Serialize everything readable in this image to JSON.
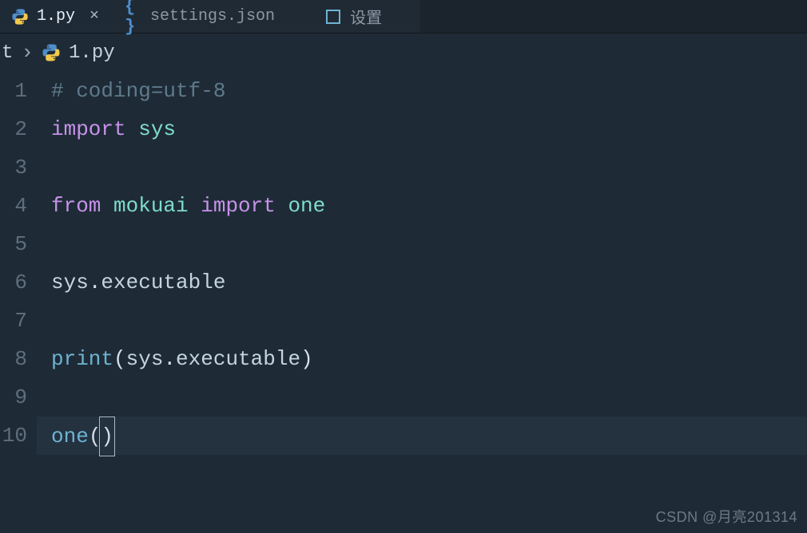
{
  "tabs": [
    {
      "label": "1.py",
      "iconName": "python-icon"
    },
    {
      "label": "settings.json",
      "iconName": "json-icon"
    },
    {
      "label": "设置",
      "iconName": "settings-icon"
    }
  ],
  "breadcrumb": {
    "parentHint": "t",
    "file": "1.py"
  },
  "code": {
    "lines": [
      {
        "n": "1",
        "tokens": [
          {
            "t": "# coding=utf-8",
            "c": "tok-comment"
          }
        ]
      },
      {
        "n": "2",
        "tokens": [
          {
            "t": "import ",
            "c": "tok-keyword"
          },
          {
            "t": "sys",
            "c": "tok-module"
          }
        ]
      },
      {
        "n": "3",
        "tokens": []
      },
      {
        "n": "4",
        "tokens": [
          {
            "t": "from ",
            "c": "tok-keyword"
          },
          {
            "t": "mokuai ",
            "c": "tok-module"
          },
          {
            "t": "import ",
            "c": "tok-keyword"
          },
          {
            "t": "one",
            "c": "tok-module"
          }
        ]
      },
      {
        "n": "5",
        "tokens": []
      },
      {
        "n": "6",
        "tokens": [
          {
            "t": "sys",
            "c": "tok-ident"
          },
          {
            "t": ".",
            "c": "tok-punct"
          },
          {
            "t": "executable",
            "c": "tok-ident"
          }
        ]
      },
      {
        "n": "7",
        "tokens": []
      },
      {
        "n": "8",
        "tokens": [
          {
            "t": "print",
            "c": "tok-builtin"
          },
          {
            "t": "(",
            "c": "tok-punct"
          },
          {
            "t": "sys",
            "c": "tok-ident"
          },
          {
            "t": ".",
            "c": "tok-punct"
          },
          {
            "t": "executable",
            "c": "tok-ident"
          },
          {
            "t": ")",
            "c": "tok-punct"
          }
        ]
      },
      {
        "n": "9",
        "tokens": []
      },
      {
        "n": "10",
        "tokens": [
          {
            "t": "one",
            "c": "tok-call"
          },
          {
            "t": "(",
            "c": "tok-punct"
          },
          {
            "t": ")",
            "c": "tok-punct",
            "boxed": true
          }
        ],
        "current": true
      }
    ]
  },
  "watermark": "CSDN @月亮201314"
}
